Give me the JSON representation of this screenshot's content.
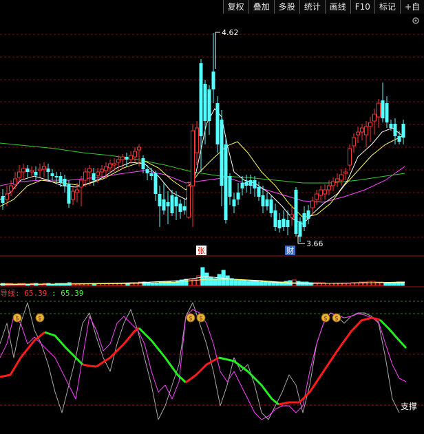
{
  "toolbar": {
    "buttons": [
      "复权",
      "叠加",
      "多股",
      "统计",
      "画线",
      "F10",
      "标记",
      "+自"
    ]
  },
  "main_chart": {
    "high_label": "4.62",
    "low_label": "3.66",
    "zhang_badge": "张",
    "cai_badge": "财"
  },
  "indicator": {
    "title_label": "导线: 65.39",
    "title_value": ": 65.39",
    "support_label": "支撑",
    "money_icon": "money-bag-icon"
  },
  "colors": {
    "up": "#ff3333",
    "down": "#54ffff",
    "ma_white": "#ffffff",
    "ma_yellow": "#ffff66",
    "ma_magenta": "#ff44ff",
    "ma_green": "#33cc33",
    "grid": "#7a1010",
    "indicator_red": "#ff1a1a",
    "indicator_green": "#22ee22"
  }
}
